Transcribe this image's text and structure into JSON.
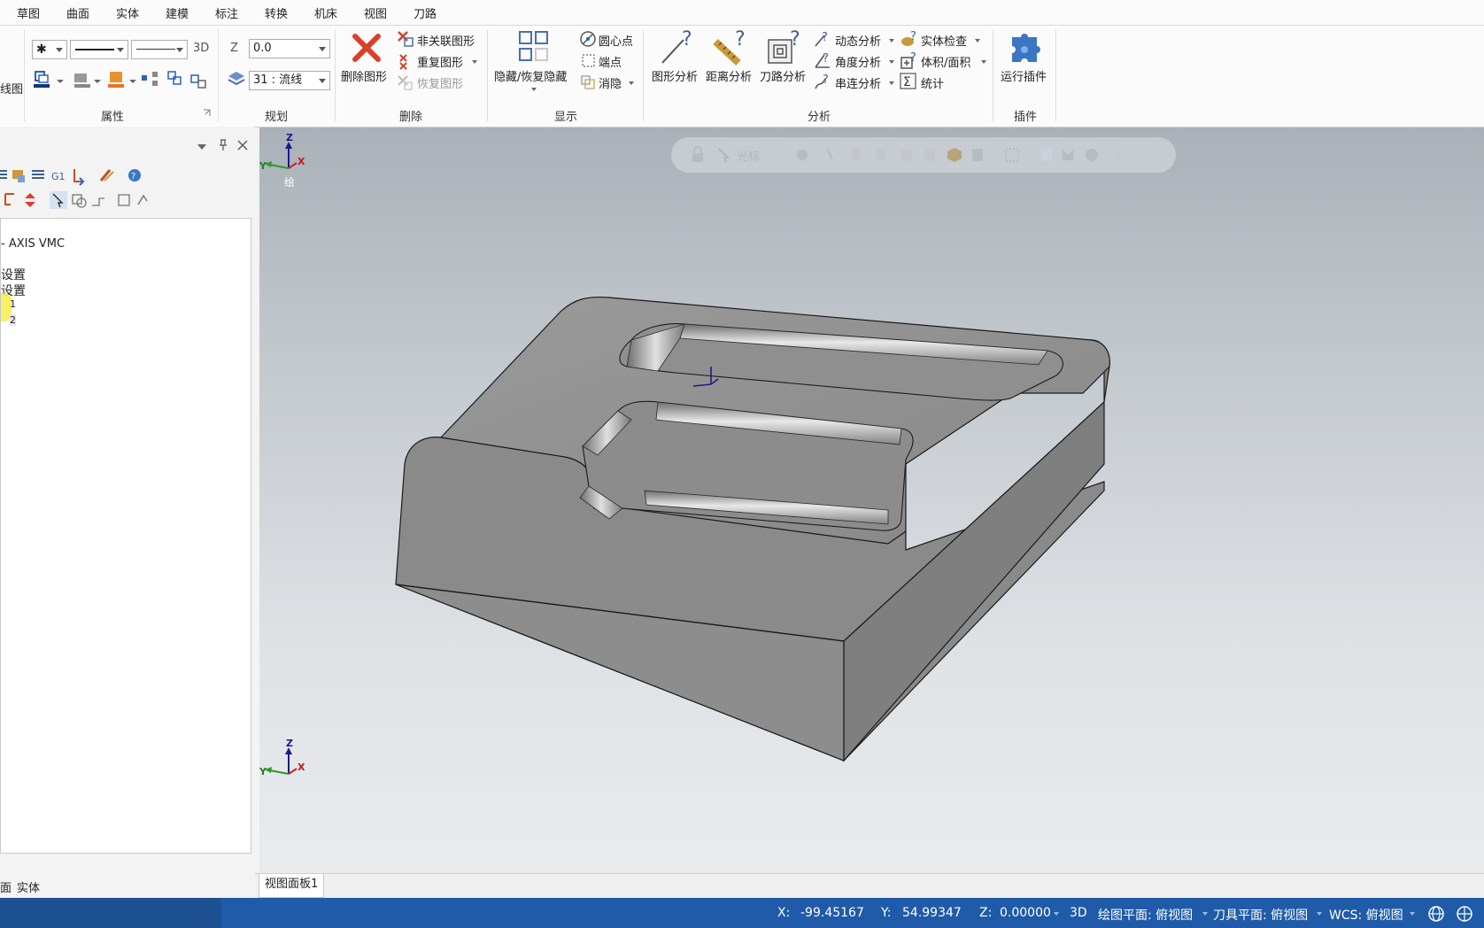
{
  "menu": [
    "草图",
    "曲面",
    "实体",
    "建模",
    "标注",
    "转换",
    "机床",
    "视图",
    "刀路"
  ],
  "ribbon": {
    "left_cut_label": "线图",
    "attributes": {
      "title": "属性",
      "mode_3d": "3D"
    },
    "planning": {
      "title": "规划",
      "z_label": "Z",
      "z_value": "0.0",
      "level_value": "31 : 流线"
    },
    "delete": {
      "title": "删除",
      "delete_entities": "删除图形",
      "non_assoc": "非关联图形",
      "duplicate": "重复图形",
      "undelete": "恢复图形"
    },
    "display": {
      "title": "显示",
      "hide_unhide": "隐藏/恢复隐藏",
      "center_point": "圆心点",
      "endpoint": "端点",
      "blank": "消隐"
    },
    "analysis": {
      "title": "分析",
      "entity_analysis": "图形分析",
      "distance_analysis": "距离分析",
      "toolpath_analysis": "刀路分析",
      "dynamic": "动态分析",
      "angle": "角度分析",
      "chain": "串连分析",
      "solid_check": "实体检查",
      "volume_area": "体积/面积",
      "statistics": "统计"
    },
    "addins": {
      "title": "插件",
      "run_addin": "运行插件"
    }
  },
  "tree": {
    "machine": "- AXIS VMC",
    "item1": "设置",
    "item2": "设置",
    "item3": "1",
    "item4": "2"
  },
  "float_toolbar_label": "光标",
  "viewport": {
    "axis_z": "Z",
    "axis_y": "Y",
    "axis_x": "X",
    "gnomon_label": "绘"
  },
  "bottom_tabs": {
    "left_partial": "面",
    "solids": "实体",
    "viewsheet": "视图面板1"
  },
  "status": {
    "x_label": "X:",
    "x_value": "-99.45167",
    "y_label": "Y:",
    "y_value": "54.99347",
    "z_label": "Z:",
    "z_value": "0.00000",
    "mode": "3D",
    "cplane": "绘图平面: 俯视图",
    "tplane": "刀具平面: 俯视图",
    "wcs": "WCS: 俯视图"
  },
  "colors": {
    "statusbar": "#1f5ba8",
    "delete_red": "#d9402a",
    "part_gray": "#8e8e8e"
  }
}
